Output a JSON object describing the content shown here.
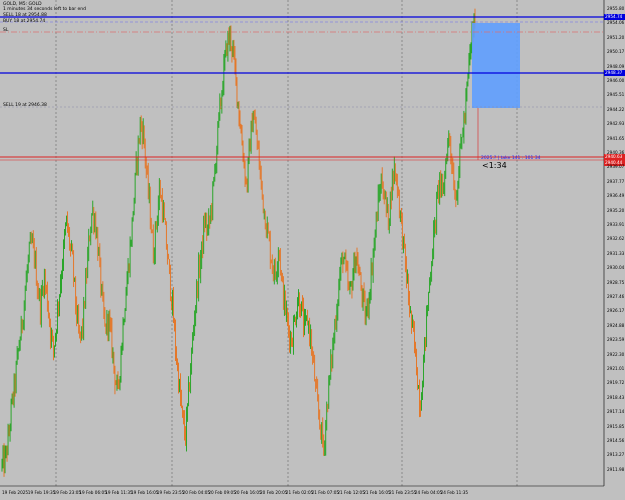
{
  "header": {
    "symbol_line": "GOLD, M5: GOLD",
    "countdown_text": "1 minutes 34 seconds left to bar end"
  },
  "levels": {
    "sell_limit_label": "SELL 18 at 2954.88",
    "buy_label": "BUY 18 at 2954.74",
    "sl_label": "SL",
    "sell_label": "SELL 19 at 2946.38"
  },
  "order_info": "2025.? | take 141 : 101 34",
  "countdown": "<1:34",
  "price_tags": {
    "blue_top": "2954.74",
    "blue_mid": "2948.37",
    "red_bid": "2940.63",
    "red_ask": "2940.44"
  },
  "colors": {
    "background": "#c0c0c0",
    "bull": "#1aa31a",
    "bear": "#e8701a",
    "level_blue": "#0000dd",
    "level_red": "#dd2222",
    "sl_red": "#d97070",
    "box": "#5f9fff"
  },
  "y_axis_labels": [
    "2955.80",
    "2954.06",
    "2951.20",
    "2950.17",
    "2948.09",
    "2946.00",
    "2945.51",
    "2944.22",
    "2942.93",
    "2941.65",
    "2940.36",
    "2939.07",
    "2937.77",
    "2936.49",
    "2935.20",
    "2933.91",
    "2932.62",
    "2931.33",
    "2930.04",
    "2928.75",
    "2927.46",
    "2926.17",
    "2924.88",
    "2923.59",
    "2922.30",
    "2921.01",
    "2919.72",
    "2918.43",
    "2917.14",
    "2915.85",
    "2914.56",
    "2913.27",
    "2911.98"
  ],
  "time_labels": [
    "19 Feb 2025",
    "19 Feb 19:35",
    "19 Feb 23:05",
    "19 Feb 06:05",
    "19 Feb 11:35",
    "19 Feb 16:05",
    "19 Feb 23:55",
    "20 Feb 04:05",
    "20 Feb 09:05",
    "20 Feb 16:05",
    "20 Feb 20:05",
    "21 Feb 02:05",
    "21 Feb 07:05",
    "21 Feb 12:05",
    "21 Feb 16:05",
    "21 Feb 23:55",
    "24 Feb 04:05",
    "24 Feb 11:35"
  ],
  "chart_data": {
    "type": "candlestick",
    "ylim": [
      2911.98,
      2955.8
    ],
    "close_path": [
      2913.5,
      2914,
      2916,
      2919,
      2921,
      2924,
      2926,
      2929,
      2932,
      2934,
      2933,
      2930,
      2928,
      2931,
      2929,
      2926,
      2924,
      2927,
      2930,
      2933,
      2936,
      2934,
      2932,
      2928,
      2925,
      2926,
      2930,
      2934,
      2937,
      2936,
      2933,
      2929,
      2926,
      2927,
      2925,
      2922,
      2920,
      2924,
      2928,
      2931,
      2934,
      2938,
      2942,
      2945,
      2944,
      2940,
      2937,
      2933,
      2936,
      2939,
      2937,
      2934,
      2931,
      2928,
      2924,
      2921,
      2918,
      2916,
      2920,
      2924,
      2928,
      2931,
      2933,
      2936,
      2935,
      2937,
      2940,
      2944,
      2947,
      2950,
      2952.5,
      2953,
      2951,
      2948,
      2945,
      2942,
      2939,
      2943,
      2946,
      2944,
      2941,
      2938,
      2936,
      2934,
      2932,
      2931,
      2934,
      2930,
      2928,
      2926,
      2925,
      2927,
      2929,
      2928,
      2926,
      2927,
      2925,
      2922,
      2919,
      2917,
      2915,
      2919,
      2922,
      2925,
      2928,
      2931,
      2933,
      2931,
      2929,
      2931,
      2933,
      2931,
      2929,
      2927,
      2929,
      2932,
      2935,
      2938,
      2940,
      2938,
      2936,
      2939,
      2941,
      2939,
      2936,
      2933,
      2930,
      2927,
      2925,
      2922,
      2919,
      2923,
      2927,
      2931,
      2934,
      2937,
      2940,
      2938,
      2942,
      2944,
      2941,
      2938,
      2941,
      2944,
      2946,
      2950,
      2953,
      2954.5
    ]
  }
}
